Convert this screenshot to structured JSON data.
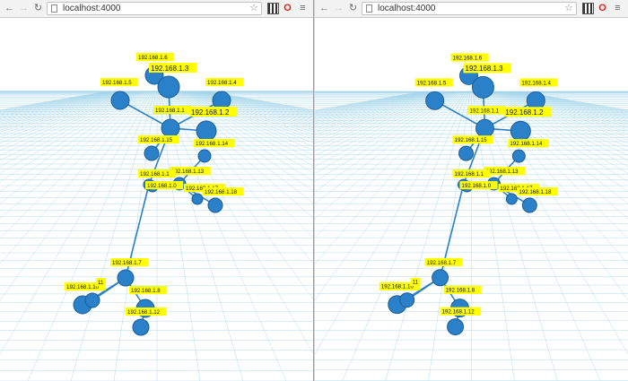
{
  "colors": {
    "label_bg": "#ffff00",
    "node": "#2a80c9",
    "node_stroke": "#1a5d96",
    "edge": "#2a80c9",
    "grid": "#9fd3e8"
  },
  "windows": [
    {
      "url": "localhost:4000"
    },
    {
      "url": "localhost:4000"
    }
  ],
  "toolbar": {
    "back_icon": "←",
    "forward_icon": "→",
    "reload_icon": "↻",
    "star_icon": "☆",
    "opera_icon": "O",
    "menu_icon": "≡"
  },
  "graph": {
    "nodes": [
      {
        "id": "n6",
        "label": "192.168.1.6",
        "big": false
      },
      {
        "id": "n3",
        "label": "192.168.1.3",
        "big": true
      },
      {
        "id": "n5",
        "label": "192.168.1.5",
        "big": false
      },
      {
        "id": "n4",
        "label": "192.168.1.4",
        "big": false
      },
      {
        "id": "n1",
        "label": "192.168.1.1",
        "big": false
      },
      {
        "id": "n2",
        "label": "192.168.1.2",
        "big": true
      },
      {
        "id": "n15",
        "label": "192.168.1.15",
        "big": false
      },
      {
        "id": "n14",
        "label": "192.168.1.14",
        "big": false
      },
      {
        "id": "n13",
        "label": "192.168.1.13",
        "big": false
      },
      {
        "id": "n1x",
        "label": "192.168.1.1",
        "big": false
      },
      {
        "id": "n17",
        "label": "192.168.1.17",
        "big": false
      },
      {
        "id": "n0",
        "label": "192.168.1.0",
        "big": false
      },
      {
        "id": "n18",
        "label": "192.168.1.18",
        "big": false
      },
      {
        "id": "n7",
        "label": "192.168.1.7",
        "big": false
      },
      {
        "id": "n10",
        "label": "192.168.1.10",
        "big": false
      },
      {
        "id": "n11",
        "label": "11",
        "big": false
      },
      {
        "id": "n8",
        "label": "192.168.1.8",
        "big": false
      },
      {
        "id": "n12",
        "label": "192.168.1.12",
        "big": false
      }
    ]
  }
}
